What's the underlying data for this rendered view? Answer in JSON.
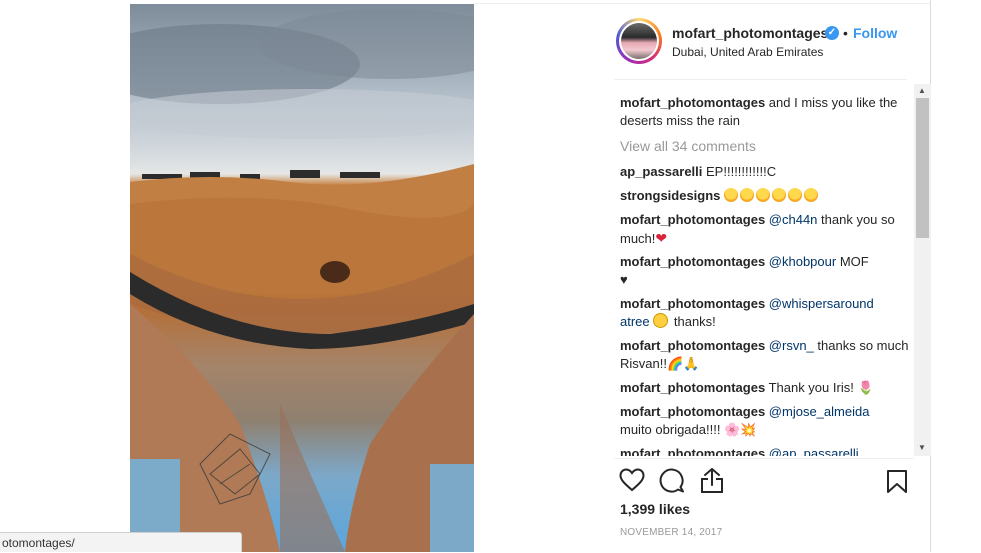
{
  "post": {
    "username": "mofart_photomontages",
    "verified_mark": "✓",
    "separator": "•",
    "follow_label": "Follow",
    "location": "Dubai, United Arab Emirates",
    "photo_icon": "photomontage-image"
  },
  "caption": {
    "user": "mofart_photomontages",
    "text": "and I miss you like the deserts miss the rain"
  },
  "view_all": "View all 34 comments",
  "comments": [
    {
      "user": "ap_passarelli",
      "text": "EP!!!!!!!!!!!!C"
    },
    {
      "user": "strongsidesigns",
      "text": "",
      "emoji": [
        "star-struck",
        "star-struck",
        "star-struck",
        "star-struck",
        "star-struck",
        "star-struck"
      ]
    },
    {
      "user": "mofart_photomontages",
      "mention": "@ch44n",
      "text": " thank you so much!",
      "trail": "❤"
    },
    {
      "user": "mofart_photomontages",
      "mention": "@khobpour",
      "text": " MOF",
      "line2": "♥"
    },
    {
      "user": "mofart_photomontages",
      "mention": "@whispersaround",
      "mention2": "atree",
      "text": " thanks!"
    },
    {
      "user": "mofart_photomontages",
      "mention": "@rsvn_",
      "text": " thanks so much Risvan!!",
      "trail": "🌈🙏"
    },
    {
      "user": "mofart_photomontages",
      "text": "Thank you Iris!",
      "trail": "🌷"
    },
    {
      "user": "mofart_photomontages",
      "mention": "@mjose_almeida",
      "text": "muito obrigada!!!!",
      "trail": "🌸💥"
    },
    {
      "user": "mofart_photomontages",
      "mention": "@ap_passarelli",
      "text": ""
    }
  ],
  "actions": {
    "like_icon": "heart-icon",
    "comment_icon": "comment-icon",
    "share_icon": "share-icon",
    "save_icon": "bookmark-icon"
  },
  "likes": "1,399 likes",
  "date": "NOVEMBER 14, 2017",
  "status_bar_url": "otomontages/",
  "colors": {
    "link_blue": "#3897f0",
    "mention_blue": "#003569",
    "text": "#262626",
    "muted": "#999999"
  }
}
